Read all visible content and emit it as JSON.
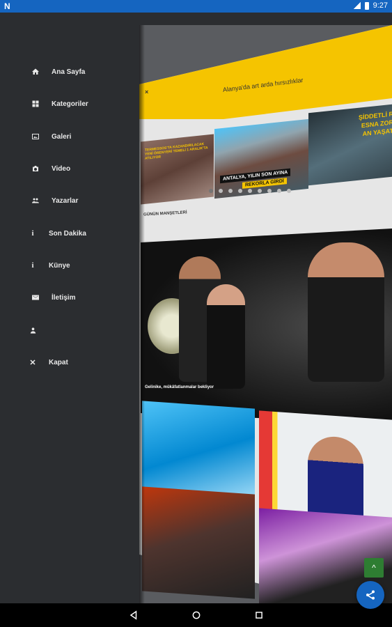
{
  "status_bar": {
    "app_icon": "N",
    "time": "9:27"
  },
  "drawer": {
    "items": [
      {
        "label": "Ana Sayfa",
        "icon": "home-icon"
      },
      {
        "label": "Kategoriler",
        "icon": "grid-icon"
      },
      {
        "label": "Galeri",
        "icon": "image-icon"
      },
      {
        "label": "Video",
        "icon": "camera-icon"
      },
      {
        "label": "Yazarlar",
        "icon": "group-icon"
      },
      {
        "label": "Son Dakika",
        "icon": "info-icon"
      },
      {
        "label": "Künye",
        "icon": "info-icon"
      },
      {
        "label": "İletişim",
        "icon": "mail-icon"
      },
      {
        "label": "",
        "icon": "user-icon"
      },
      {
        "label": "Kapat",
        "icon": "close-icon"
      }
    ]
  },
  "preview": {
    "header_text": "Alanya'da art arda hırsızlıklar",
    "close_glyph": "×",
    "slides": [
      {
        "caption": "TERMESSOS'TA KAZANDIRILACAK YENİ ÖRENYERİ TEMELİ 1 ARALIK'TA ATILIYOR"
      },
      {
        "caption_line1": "ANTALYA, YILIN SON AYINA",
        "caption_line2": "REKORLA GİRDİ"
      },
      {
        "caption": "ŞİDDETLİ R ESNA ZOR AN YAŞAT"
      }
    ],
    "dots_count": 9,
    "section_label": "GÜNÜN MANŞETLERİ",
    "hero_caption": "Gelinike, mükâfatlanmalar bekliyor",
    "fab_top_glyph": "^"
  },
  "colors": {
    "status_bar": "#1565c0",
    "drawer_bg": "#2b2d30",
    "accent_yellow": "#f5c400",
    "fab_green": "#2e7d32",
    "fab_blue": "#1565c0"
  }
}
